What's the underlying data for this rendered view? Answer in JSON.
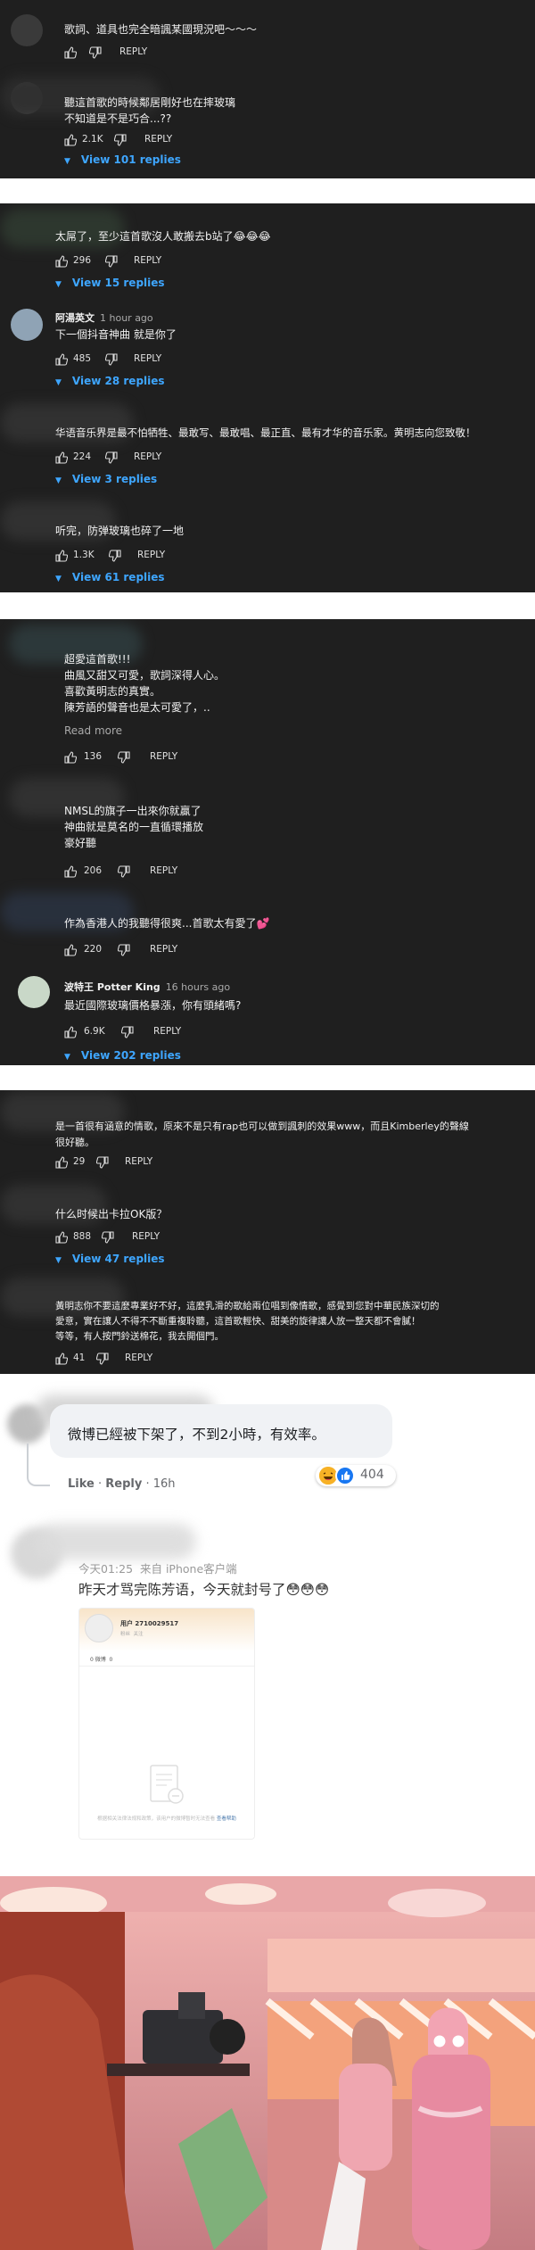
{
  "panel1": {
    "c1": {
      "text": "歌詞、道具也完全暗諷某國現況吧～～～",
      "likes": "",
      "reply": "REPLY"
    },
    "c2": {
      "text": "聽這首歌的時候鄰居剛好也在摔玻璃\n不知道是不是巧合...??",
      "likes": "2.1K",
      "reply": "REPLY",
      "replies": "View 101 replies"
    }
  },
  "panel2": {
    "c1": {
      "text": "太屌了，至少這首歌沒人敢搬去b站了😂😂😂",
      "likes": "296",
      "reply": "REPLY",
      "replies": "View 15 replies"
    },
    "c2": {
      "author": "阿湯英文",
      "time": "1 hour ago",
      "text": "下一個抖音神曲 就是你了",
      "likes": "485",
      "reply": "REPLY",
      "replies": "View 28 replies"
    },
    "c3": {
      "text": "华语音乐界是最不怕牺牲、最敢写、最敢唱、最正直、最有才华的音乐家。黄明志向您致敬！",
      "likes": "224",
      "reply": "REPLY",
      "replies": "View 3 replies"
    },
    "c4": {
      "text": "听完，防弹玻璃也碎了一地",
      "likes": "1.3K",
      "reply": "REPLY",
      "replies": "View 61 replies"
    }
  },
  "panel3": {
    "c1": {
      "text": "超愛這首歌!!!\n曲風又甜又可愛，歌詞深得人心。\n喜歡黃明志的真實。\n陳芳語的聲音也是太可愛了，..",
      "readmore": "Read more",
      "likes": "136",
      "reply": "REPLY"
    },
    "c2": {
      "text": "NMSL的旗子一出來你就贏了\n神曲就是莫名的一直循環播放\n豪好聽",
      "likes": "206",
      "reply": "REPLY"
    },
    "c3": {
      "text": "作為香港人的我聽得很爽...首歌太有愛了💕",
      "likes": "220",
      "reply": "REPLY"
    },
    "c4": {
      "author": "波特王 Potter King",
      "time": "16 hours ago",
      "text": "最近國際玻璃價格暴漲，你有頭緒嗎?",
      "likes": "6.9K",
      "reply": "REPLY",
      "replies": "View 202 replies"
    }
  },
  "panel4": {
    "c1": {
      "text": "是一首很有涵意的情歌，原來不是只有rap也可以做到諷刺的效果www，而且Kimberley的聲線\n很好聽。",
      "likes": "29",
      "reply": "REPLY"
    },
    "c2": {
      "text": "什么时候出卡拉OK版？",
      "likes": "888",
      "reply": "REPLY",
      "replies": "View 47 replies"
    },
    "c3": {
      "text": "黃明志你不要這麼專業好不好，這麼乳滑的歌給兩位唱到像情歌，感覺到您對中華民族深切的\n愛意，實在讓人不得不不斷重複聆聽，這首歌輕快、甜美的旋律讓人放一整天都不會膩！\n等等，有人按門鈴送棉花，我去開個門。",
      "likes": "41",
      "reply": "REPLY"
    }
  },
  "facebook": {
    "text": "微博已經被下架了，不到2小時，有效率。",
    "like": "Like",
    "reply": "Reply",
    "time": "16h",
    "reaction_count": "404"
  },
  "weibo": {
    "meta": "今天01:25  来自 iPhone客户端",
    "text": "昨天才骂完陈芳语，今天就封号了😳😳😳",
    "card_user": "用户 2710029517",
    "card_sub": "粉丝  关注",
    "card_stat": "0 微博  0",
    "card_notice": "根据相关法律法规和政策，该用户的微博暂时无法查看",
    "card_link": "查看帮助"
  },
  "colors": {
    "dark_bg": "#1f1f1f",
    "link_blue": "#3ea6ff",
    "text_light": "#f1f1f1",
    "fb_bubble": "#f0f2f5"
  }
}
